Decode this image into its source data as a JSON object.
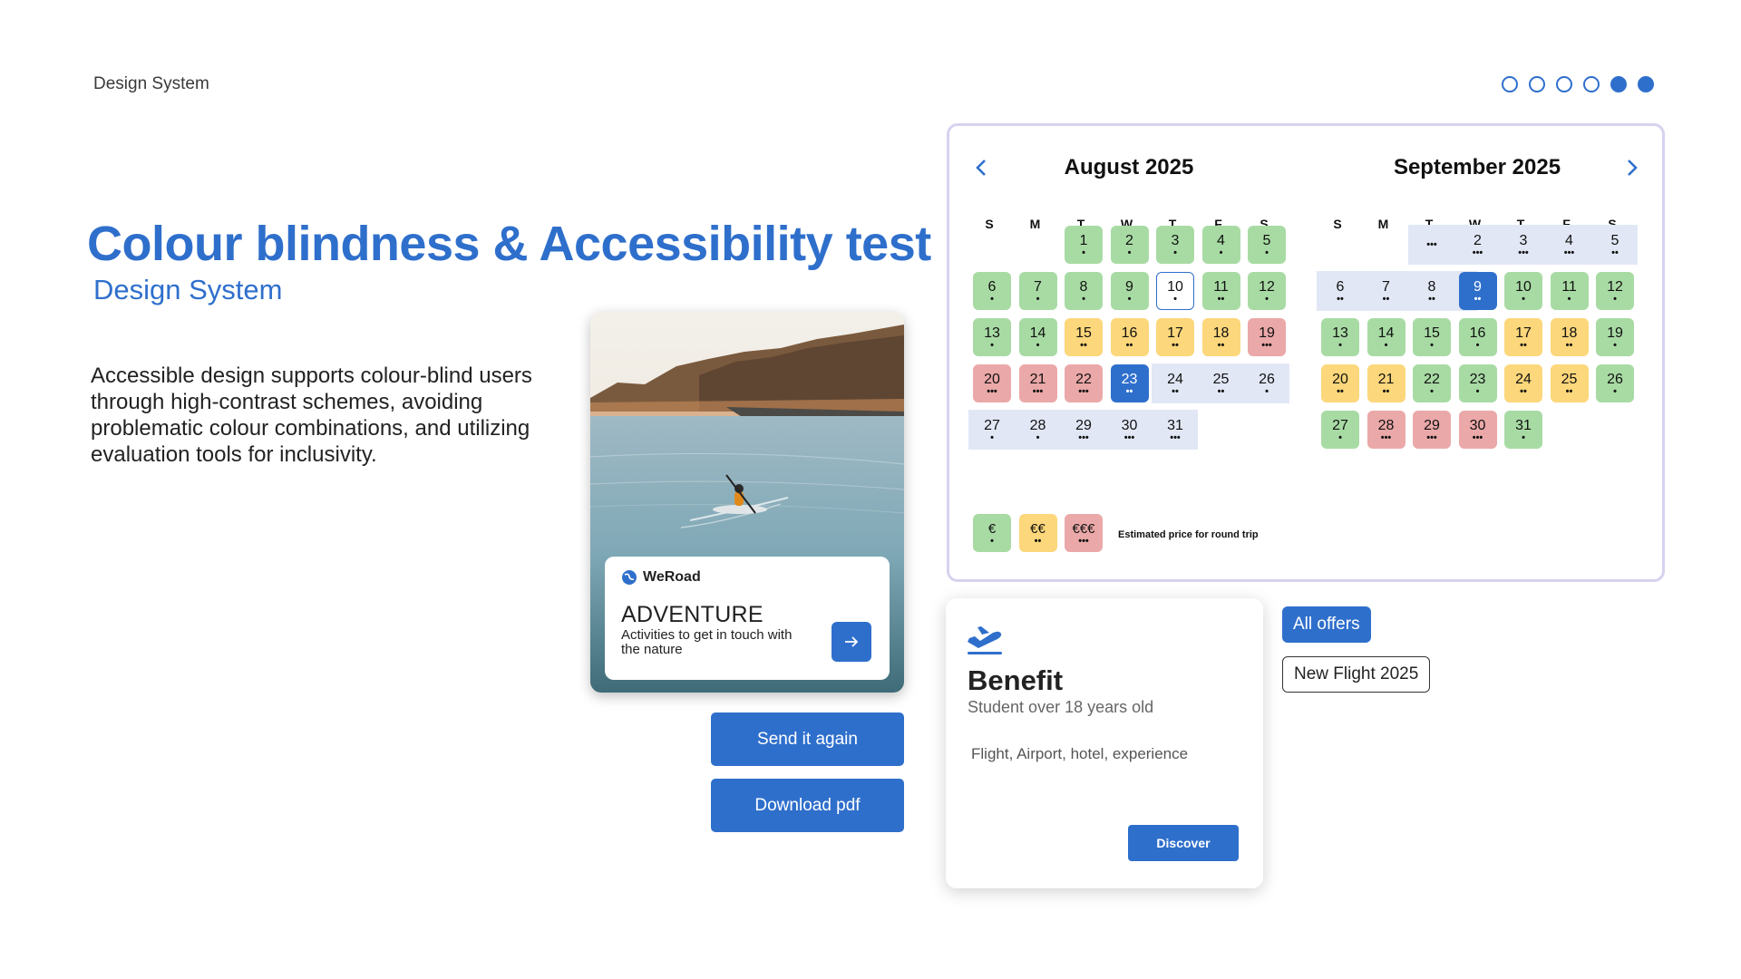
{
  "header": {
    "label": "Design System"
  },
  "pager": {
    "active": [
      4,
      5
    ],
    "count": 6
  },
  "hero": {
    "title": "Colour blindness & Accessibility test",
    "subtitle": "Design System",
    "description": "Accessible design supports colour-blind users through high-contrast schemes, avoiding problematic colour combinations, and utilizing evaluation tools for inclusivity."
  },
  "adventure_card": {
    "brand": "WeRoad",
    "title": "ADVENTURE",
    "description": "Activities to get in touch with the nature"
  },
  "buttons": {
    "send_again": "Send it again",
    "download_pdf": "Download pdf"
  },
  "calendar": {
    "weekdays": [
      "S",
      "M",
      "T",
      "W",
      "T",
      "F",
      "S"
    ],
    "legend": {
      "items": [
        "€",
        "€€",
        "€€€"
      ],
      "label": "Estimated price for round trip"
    },
    "colors": {
      "green": "#a8dba4",
      "yellow": "#fcd77b",
      "red": "#eba8a8",
      "selected": "#2f6fcc",
      "band": "#e1e7f5"
    },
    "months": [
      {
        "title": "August 2025",
        "days": [
          {
            "d": "1",
            "price": "€",
            "color": "green"
          },
          {
            "d": "2",
            "price": "€",
            "color": "green"
          },
          {
            "d": "3",
            "price": "€",
            "color": "green"
          },
          {
            "d": "4",
            "price": "€",
            "color": "green"
          },
          {
            "d": "5",
            "price": "€",
            "color": "green"
          },
          {
            "d": "6",
            "price": "€",
            "color": "green"
          },
          {
            "d": "7",
            "price": "€",
            "color": "green"
          },
          {
            "d": "8",
            "price": "€",
            "color": "green"
          },
          {
            "d": "9",
            "price": "€",
            "color": "green"
          },
          {
            "d": "10",
            "price": "€",
            "color": "today"
          },
          {
            "d": "11",
            "price": "€€",
            "color": "green"
          },
          {
            "d": "12",
            "price": "€",
            "color": "green"
          },
          {
            "d": "13",
            "price": "€",
            "color": "green"
          },
          {
            "d": "14",
            "price": "€",
            "color": "green"
          },
          {
            "d": "15",
            "price": "€€",
            "color": "yellow"
          },
          {
            "d": "16",
            "price": "€€",
            "color": "yellow"
          },
          {
            "d": "17",
            "price": "€€",
            "color": "yellow"
          },
          {
            "d": "18",
            "price": "€€",
            "color": "yellow"
          },
          {
            "d": "19",
            "price": "€€€",
            "color": "red"
          },
          {
            "d": "20",
            "price": "€€€",
            "color": "red"
          },
          {
            "d": "21",
            "price": "€€€",
            "color": "red"
          },
          {
            "d": "22",
            "price": "€€€",
            "color": "red"
          },
          {
            "d": "23",
            "price": "€€",
            "color": "selected"
          },
          {
            "d": "24",
            "price": "€€",
            "color": "band"
          },
          {
            "d": "25",
            "price": "€€",
            "color": "band"
          },
          {
            "d": "26",
            "price": "€",
            "color": "band"
          },
          {
            "d": "27",
            "price": "€",
            "color": "band"
          },
          {
            "d": "28",
            "price": "€",
            "color": "band"
          },
          {
            "d": "29",
            "price": "€€€",
            "color": "band"
          },
          {
            "d": "30",
            "price": "€€€",
            "color": "band"
          },
          {
            "d": "31",
            "price": "€€€",
            "color": "band"
          }
        ]
      },
      {
        "title": "September 2025",
        "days": [
          {
            "d": "",
            "price": "€€€",
            "color": "band"
          },
          {
            "d": "2",
            "price": "€€€",
            "color": "band"
          },
          {
            "d": "3",
            "price": "€€€",
            "color": "band"
          },
          {
            "d": "4",
            "price": "€€€",
            "color": "band"
          },
          {
            "d": "5",
            "price": "€€",
            "color": "band"
          },
          {
            "d": "6",
            "price": "€€",
            "color": "band"
          },
          {
            "d": "7",
            "price": "€€",
            "color": "band"
          },
          {
            "d": "8",
            "price": "€€",
            "color": "band"
          },
          {
            "d": "9",
            "price": "€€",
            "color": "selected"
          },
          {
            "d": "10",
            "price": "€",
            "color": "green"
          },
          {
            "d": "11",
            "price": "€",
            "color": "green"
          },
          {
            "d": "12",
            "price": "€",
            "color": "green"
          },
          {
            "d": "13",
            "price": "€",
            "color": "green"
          },
          {
            "d": "14",
            "price": "€",
            "color": "green"
          },
          {
            "d": "15",
            "price": "€",
            "color": "green"
          },
          {
            "d": "16",
            "price": "€",
            "color": "green"
          },
          {
            "d": "17",
            "price": "€€",
            "color": "yellow"
          },
          {
            "d": "18",
            "price": "€€",
            "color": "yellow"
          },
          {
            "d": "19",
            "price": "€",
            "color": "green"
          },
          {
            "d": "20",
            "price": "€€",
            "color": "yellow"
          },
          {
            "d": "21",
            "price": "€€",
            "color": "yellow"
          },
          {
            "d": "22",
            "price": "€",
            "color": "green"
          },
          {
            "d": "23",
            "price": "€",
            "color": "green"
          },
          {
            "d": "24",
            "price": "€€",
            "color": "yellow"
          },
          {
            "d": "25",
            "price": "€€",
            "color": "yellow"
          },
          {
            "d": "26",
            "price": "€",
            "color": "green"
          },
          {
            "d": "27",
            "price": "€",
            "color": "green"
          },
          {
            "d": "28",
            "price": "€€€",
            "color": "red"
          },
          {
            "d": "29",
            "price": "€€€",
            "color": "red"
          },
          {
            "d": "30",
            "price": "€€€",
            "color": "red"
          },
          {
            "d": "31",
            "price": "€",
            "color": "green"
          }
        ]
      }
    ]
  },
  "benefit": {
    "title": "Benefit",
    "subtitle": "Student over 18 years old",
    "features": "Flight, Airport, hotel, experience",
    "button": "Discover"
  },
  "chips": {
    "all_offers": "All offers",
    "new_flight": "New Flight 2025"
  }
}
